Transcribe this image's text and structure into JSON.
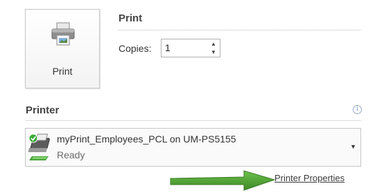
{
  "print": {
    "button_label": "Print",
    "section_title": "Print",
    "copies_label": "Copies:",
    "copies_value": "1"
  },
  "printer": {
    "section_title": "Printer",
    "info_glyph": "i",
    "selected_name": "myPrint_Employees_PCL on UM-PS5155",
    "selected_status": "Ready",
    "properties_link": "Printer Properties"
  },
  "icons": {
    "print_button": "printer-icon",
    "printer_select": "printer-ready-icon",
    "dropdown": "chevron-down-icon",
    "spin_up": "spin-up-icon",
    "spin_down": "spin-down-icon",
    "info": "info-icon",
    "annotation": "green-arrow"
  },
  "colors": {
    "annotation_arrow": "#4a9a2e",
    "status_check": "#3aa83a"
  }
}
